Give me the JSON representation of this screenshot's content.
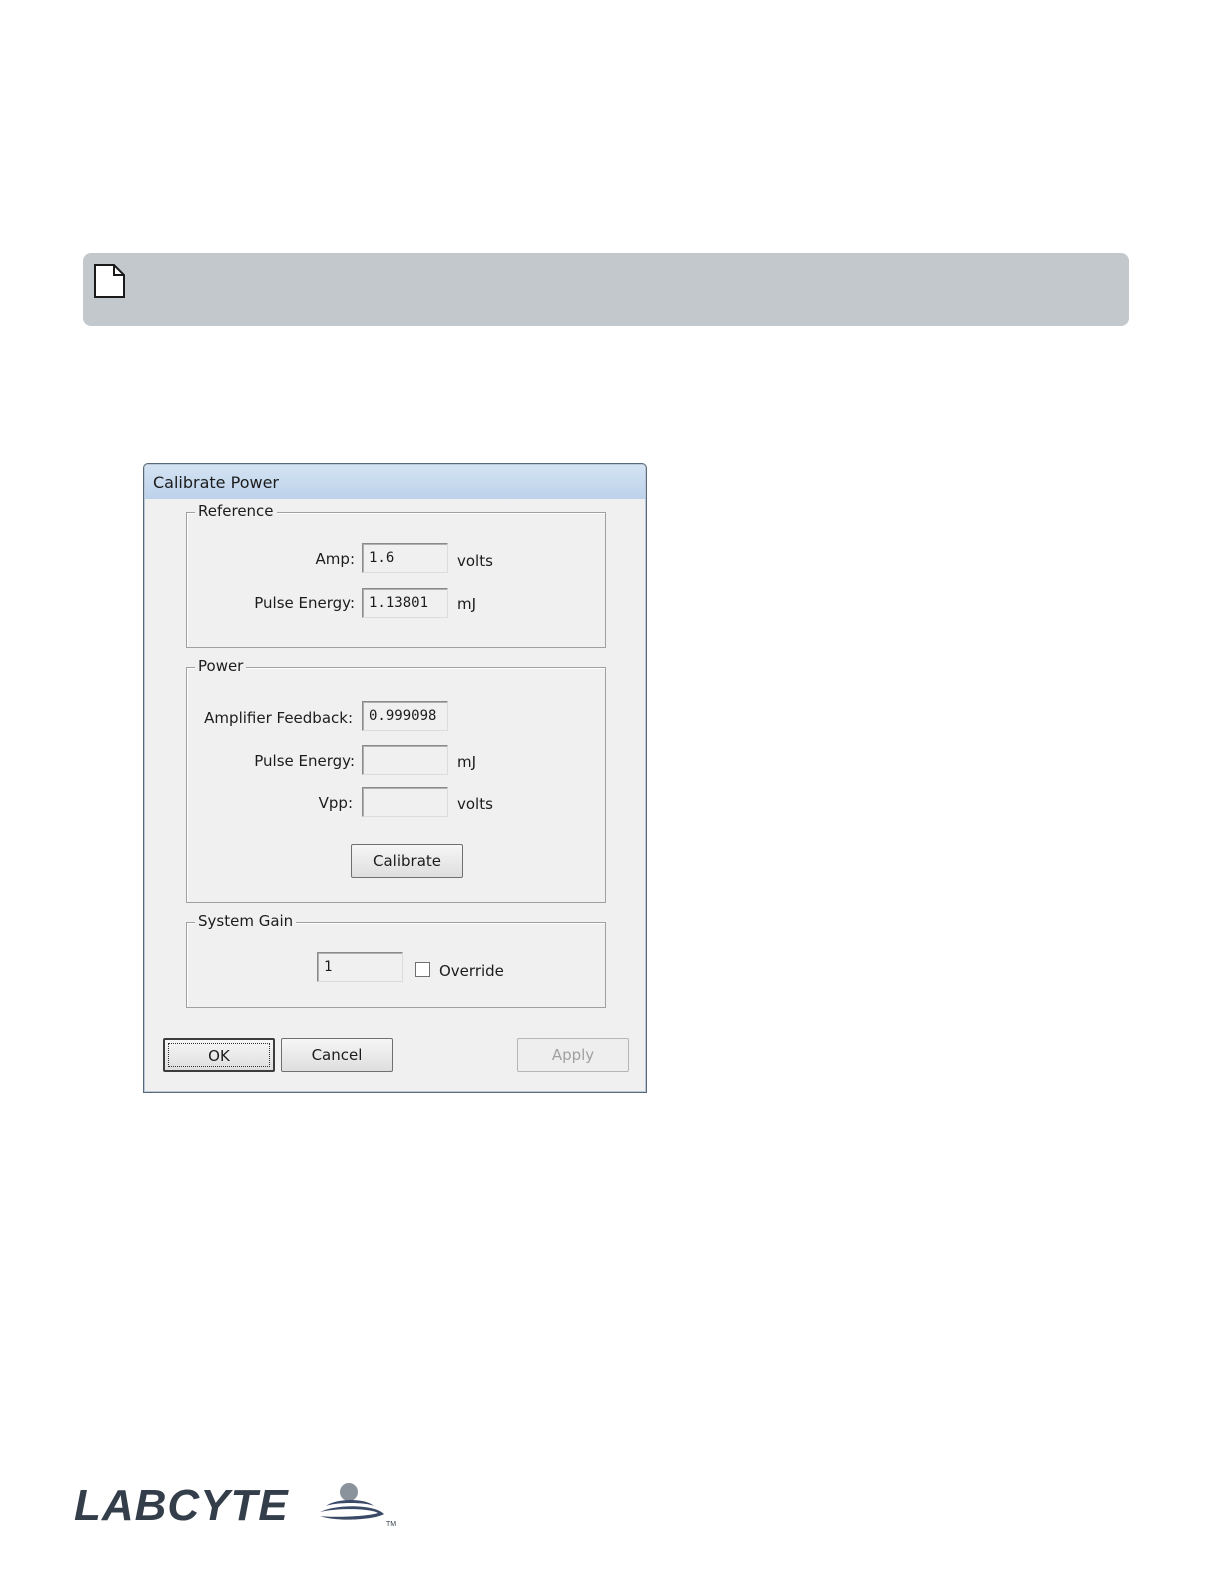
{
  "note": {
    "icon": "note-page-icon"
  },
  "dialog": {
    "title": "Calibrate Power",
    "reference": {
      "label": "Reference",
      "amp_label": "Amp:",
      "amp_value": "1.6",
      "amp_unit": "volts",
      "pulse_label": "Pulse Energy:",
      "pulse_value": "1.13801",
      "pulse_unit": "mJ"
    },
    "power": {
      "label": "Power",
      "feedback_label": "Amplifier Feedback:",
      "feedback_value": "0.999098",
      "pulse_label": "Pulse Energy:",
      "pulse_value": "",
      "pulse_unit": "mJ",
      "vpp_label": "Vpp:",
      "vpp_value": "",
      "vpp_unit": "volts",
      "calibrate_label": "Calibrate"
    },
    "gain": {
      "label": "System Gain",
      "value": "1",
      "override_label": "Override",
      "override_checked": false
    },
    "buttons": {
      "ok": "OK",
      "cancel": "Cancel",
      "apply": "Apply"
    }
  },
  "logo": {
    "text": "LABCYTE",
    "tm": "TM",
    "colors": {
      "text": "#333e4a",
      "swoosh": "#3a4a66",
      "drop": "#8a929c"
    }
  }
}
